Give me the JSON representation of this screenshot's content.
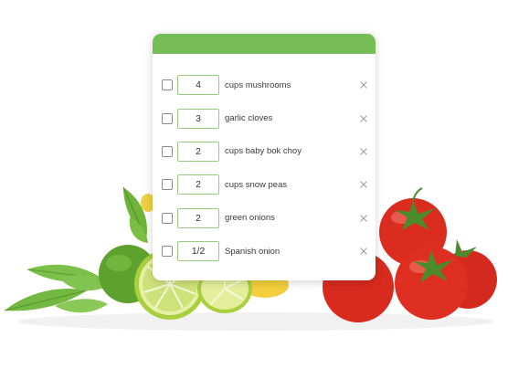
{
  "colors": {
    "header_accent": "#76bd55",
    "field_border": "#9acb84",
    "text": "#3a3a3a"
  },
  "icons": {
    "checkbox": "empty-checkbox-icon",
    "remove": "close-x-icon"
  },
  "ingredients": [
    {
      "qty": "4",
      "label": "cups mushrooms",
      "checked": false
    },
    {
      "qty": "3",
      "label": "garlic cloves",
      "checked": false
    },
    {
      "qty": "2",
      "label": "cups baby bok choy",
      "checked": false
    },
    {
      "qty": "2",
      "label": "cups snow peas",
      "checked": false
    },
    {
      "qty": "2",
      "label": "green onions",
      "checked": false
    },
    {
      "qty": "1/2",
      "label": "Spanish onion",
      "checked": false
    }
  ]
}
